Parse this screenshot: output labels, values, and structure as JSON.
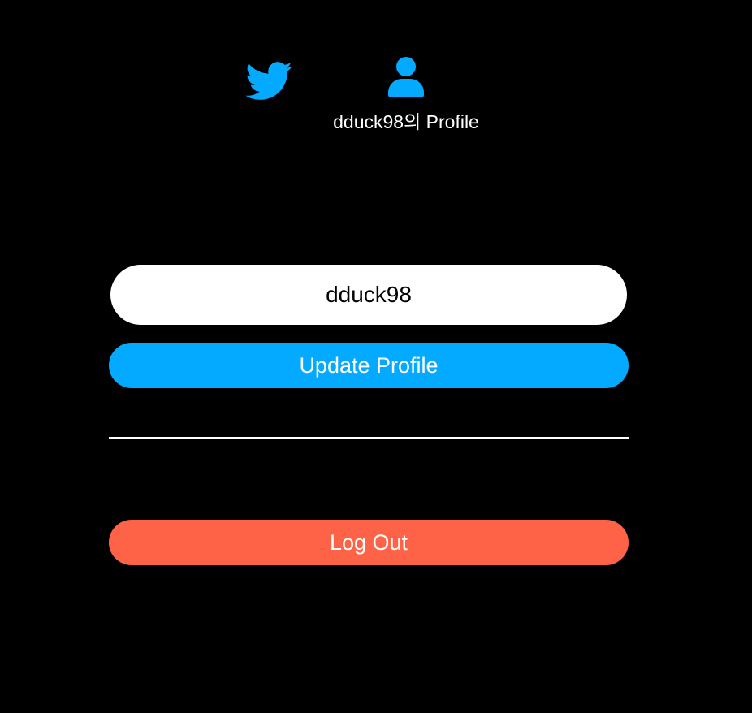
{
  "nav": {
    "home_icon": "twitter-bird-icon",
    "profile_icon": "user-icon",
    "profile_label": "dduck98의 Profile"
  },
  "form": {
    "display_name_value": "dduck98",
    "update_button_label": "Update Profile"
  },
  "logout_button_label": "Log Out",
  "colors": {
    "accent": "#04aaff",
    "danger": "#ff6347",
    "background": "#000000"
  }
}
